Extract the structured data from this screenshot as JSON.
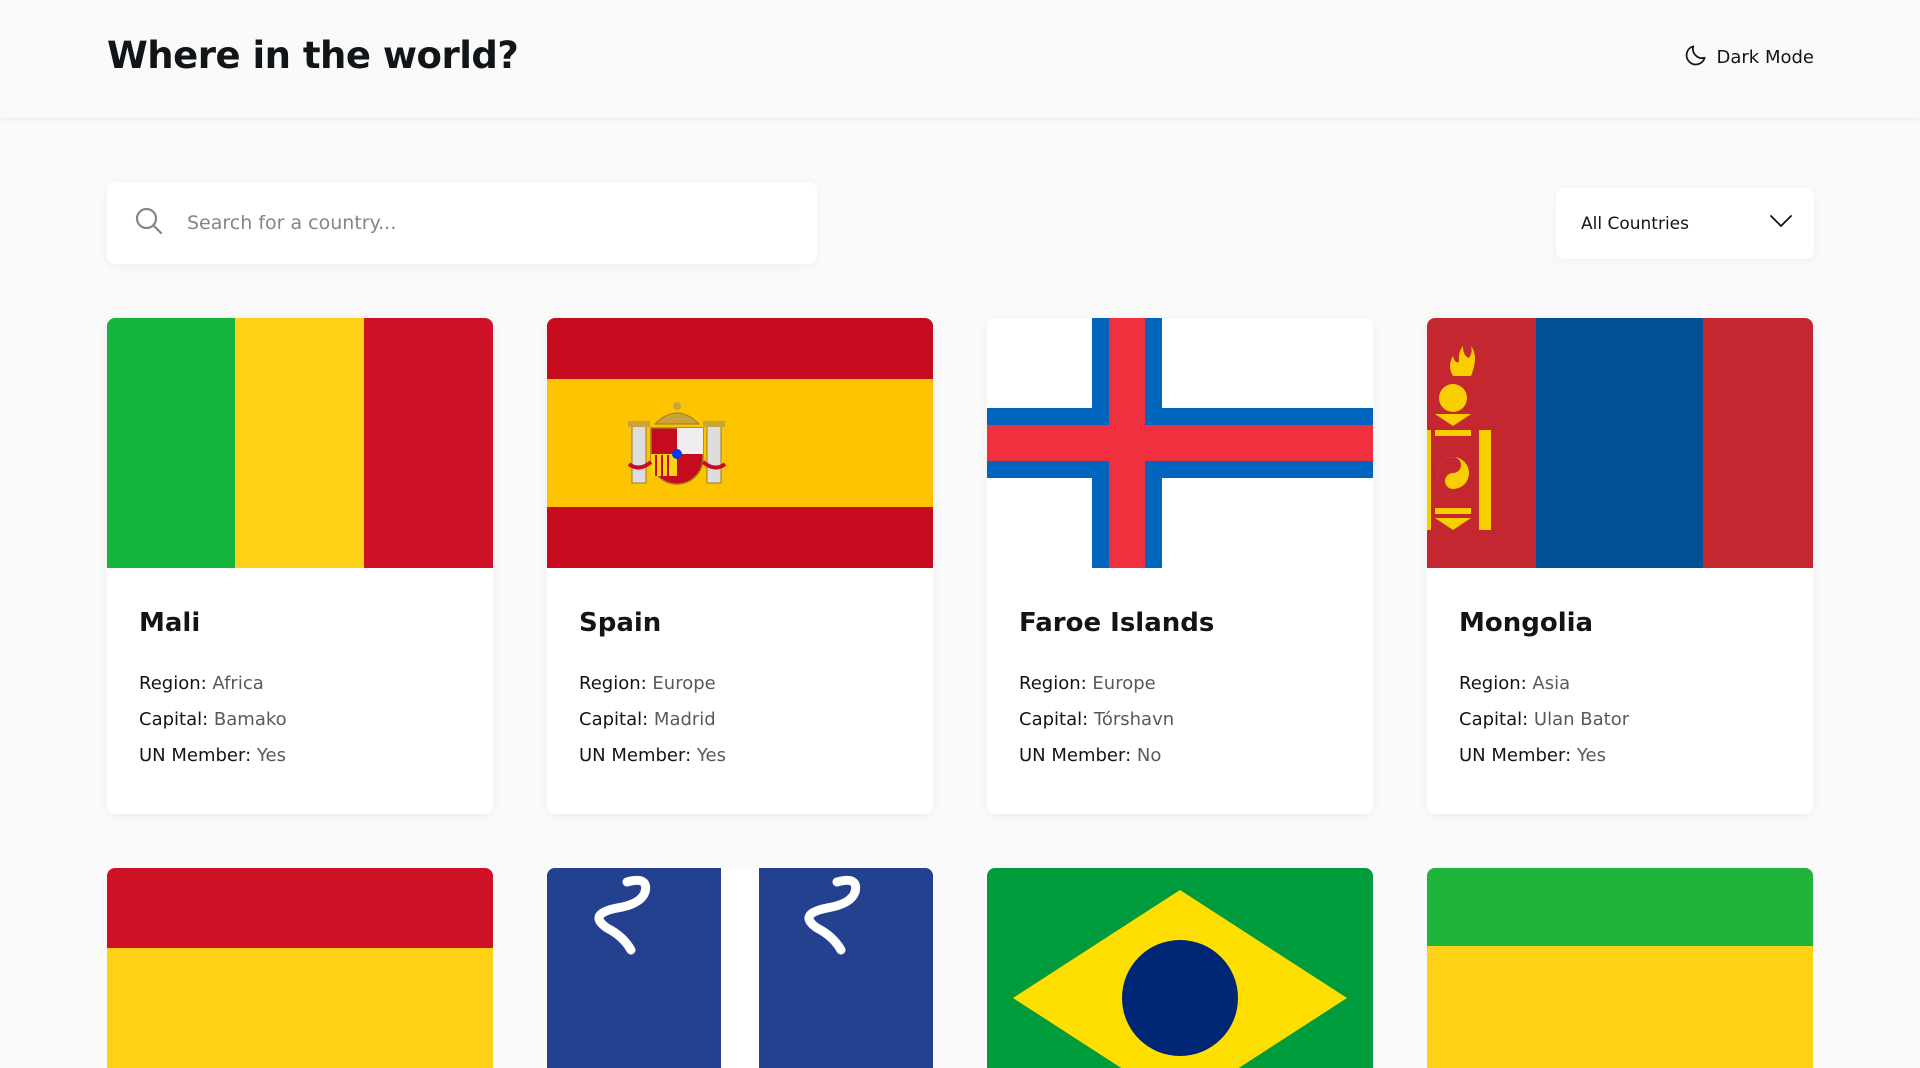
{
  "header": {
    "title": "Where in the world?",
    "mode_label": "Dark Mode"
  },
  "search": {
    "placeholder": "Search for a country...",
    "value": ""
  },
  "filter": {
    "selected": "All Countries"
  },
  "labels": {
    "region": "Region:",
    "capital": "Capital:",
    "un": "UN Member:"
  },
  "countries": [
    {
      "name": "Mali",
      "region": "Africa",
      "capital": "Bamako",
      "un": "Yes"
    },
    {
      "name": "Spain",
      "region": "Europe",
      "capital": "Madrid",
      "un": "Yes"
    },
    {
      "name": "Faroe Islands",
      "region": "Europe",
      "capital": "Tórshavn",
      "un": "No"
    },
    {
      "name": "Mongolia",
      "region": "Asia",
      "capital": "Ulan Bator",
      "un": "Yes"
    }
  ],
  "icons": {
    "mode": "moon-icon",
    "search": "search-icon",
    "filter": "chevron-down-icon"
  }
}
